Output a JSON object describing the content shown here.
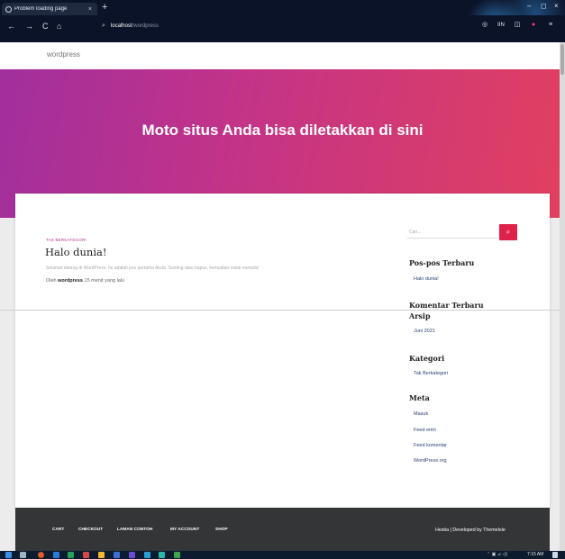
{
  "browser": {
    "tab_title": "Problem loading page",
    "tab_close": "×",
    "new_tab": "+",
    "url_host": "localhost",
    "url_path": "/wordpress",
    "nav": {
      "back": "←",
      "forward": "→",
      "reload": "C",
      "home": "⌂"
    },
    "window": {
      "minimize": "–",
      "maximize": "◻",
      "close": "×"
    },
    "extensions": [
      "◎",
      "IIN",
      "◫",
      "●"
    ],
    "menu": "≡"
  },
  "site": {
    "name": "wordpress",
    "tagline": "Moto situs Anda bisa diletakkan di sini"
  },
  "post": {
    "category": "TAK BERKATEGORI",
    "title": "Halo dunia!",
    "excerpt": "Selamat datang di WordPress. Ini adalah pos pertama Anda. Sunting atau hapus, kemudian mulai menulis!",
    "byline_prefix": "Oleh ",
    "author": "wordpress",
    "time": " 15 menit yang lalu"
  },
  "sidebar": {
    "search_placeholder": "Cari...",
    "search_icon": "search-icon",
    "recent_posts_title": "Pos-pos Terbaru",
    "recent_posts": [
      "Halo dunia!"
    ],
    "recent_comments_title": "Komentar Terbaru",
    "archives_title": "Arsip",
    "archives": [
      "Juni 2021"
    ],
    "categories_title": "Kategori",
    "categories": [
      "Tak Berkategori"
    ],
    "meta_title": "Meta",
    "meta": [
      "Masuk",
      "Feed entri",
      "Feed komentar",
      "WordPress.org"
    ]
  },
  "footer": {
    "nav": [
      "CART",
      "CHECKOUT",
      "LAMAN CONTOH",
      "MY ACCOUNT",
      "SHOP"
    ],
    "credit": "Hestia | Developed by ThemeIsle"
  },
  "taskbar": {
    "clock": "7:15 AM",
    "tray": "⌃ ▣ ⊿ ◁)"
  },
  "colors": {
    "accent": "#e0224a",
    "hero_start": "#a12f9d",
    "hero_end": "#e2405f",
    "category": "#b23590",
    "footer_bg": "#333537",
    "chrome_bg": "#0b1328"
  }
}
